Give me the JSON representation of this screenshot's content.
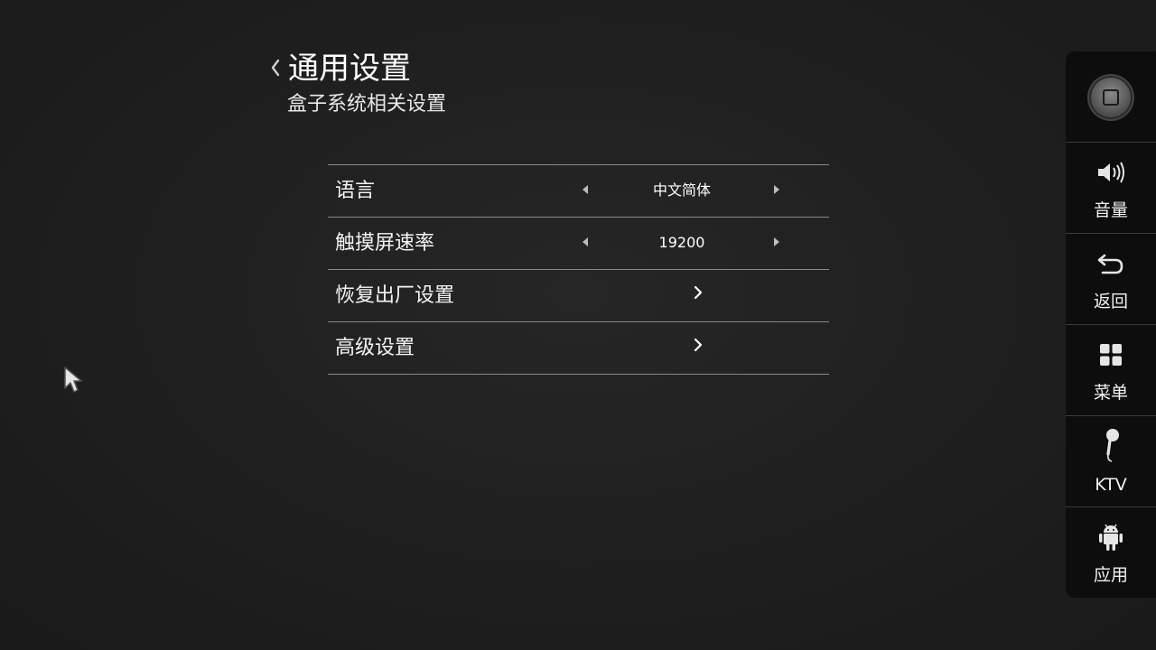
{
  "header": {
    "title": "通用设置",
    "subtitle": "盒子系统相关设置"
  },
  "settings": [
    {
      "label": "语言",
      "value": "中文简体",
      "type": "selector"
    },
    {
      "label": "触摸屏速率",
      "value": "19200",
      "type": "selector"
    },
    {
      "label": "恢复出厂设置",
      "type": "link"
    },
    {
      "label": "高级设置",
      "type": "link"
    }
  ],
  "side_panel": {
    "items": [
      {
        "icon": "home-icon",
        "label": ""
      },
      {
        "icon": "volume-icon",
        "label": "音量"
      },
      {
        "icon": "back-arrow-icon",
        "label": "返回"
      },
      {
        "icon": "menu-grid-icon",
        "label": "菜单"
      },
      {
        "icon": "microphone-icon",
        "label": "KTV"
      },
      {
        "icon": "android-icon",
        "label": "应用"
      }
    ]
  },
  "colors": {
    "background": "#1e1e1e",
    "divider": "#8a8a8a",
    "panel": "#0d0d0d",
    "text": "#f2f2f2"
  }
}
